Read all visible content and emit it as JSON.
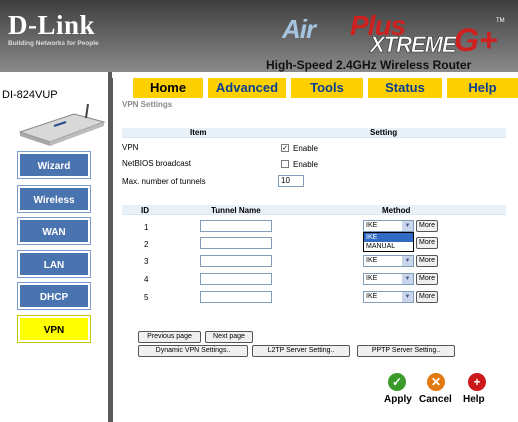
{
  "brand": {
    "name": "D-Link",
    "tagline": "Building Networks for People"
  },
  "product": {
    "air": "Air",
    "plus": "Plus",
    "xtreme": "XTREME",
    "g": "G+",
    "tm": "TM",
    "subtitle": "High-Speed 2.4GHz Wireless Router"
  },
  "model": "DI-824VUP",
  "nav": {
    "wizard": "Wizard",
    "wireless": "Wireless",
    "wan": "WAN",
    "lan": "LAN",
    "dhcp": "DHCP",
    "vpn": "VPN"
  },
  "tabs": {
    "home": "Home",
    "advanced": "Advanced",
    "tools": "Tools",
    "status": "Status",
    "help": "Help"
  },
  "page_title": "VPN Settings",
  "settings": {
    "col_item": "Item",
    "col_setting": "Setting",
    "vpn_label": "VPN",
    "vpn_enable": "Enable",
    "vpn_checked": "✓",
    "netbios_label": "NetBIOS broadcast",
    "netbios_enable": "Enable",
    "max_label": "Max. number of tunnels",
    "max_value": "10"
  },
  "tunnels": {
    "col_id": "ID",
    "col_name": "Tunnel Name",
    "col_method": "Method",
    "rows": [
      {
        "id": "1",
        "name": "",
        "method": "IKE",
        "more": "More"
      },
      {
        "id": "2",
        "name": "",
        "method": "IKE",
        "more": "More"
      },
      {
        "id": "3",
        "name": "",
        "method": "IKE",
        "more": "More"
      },
      {
        "id": "4",
        "name": "",
        "method": "IKE",
        "more": "More"
      },
      {
        "id": "5",
        "name": "",
        "method": "IKE",
        "more": "More"
      }
    ],
    "dropdown_options": [
      "IKE",
      "MANUAL"
    ]
  },
  "buttons": {
    "prev": "Previous page",
    "next": "Next page",
    "dynamic": "Dynamic VPN Settings..",
    "l2tp": "L2TP Server Setting..",
    "pptp": "PPTP Server Setting.."
  },
  "actions": {
    "apply": "Apply",
    "cancel": "Cancel",
    "help": "Help"
  },
  "colors": {
    "nav_button": "#4a74b0",
    "active_nav": "#ffff00",
    "tab_bar": "#ffd000",
    "tab_text": "#0b3f91",
    "table_header": "#e8f0f8",
    "apply": "#3a9a2a",
    "cancel": "#e07a10",
    "help": "#cc1818"
  }
}
